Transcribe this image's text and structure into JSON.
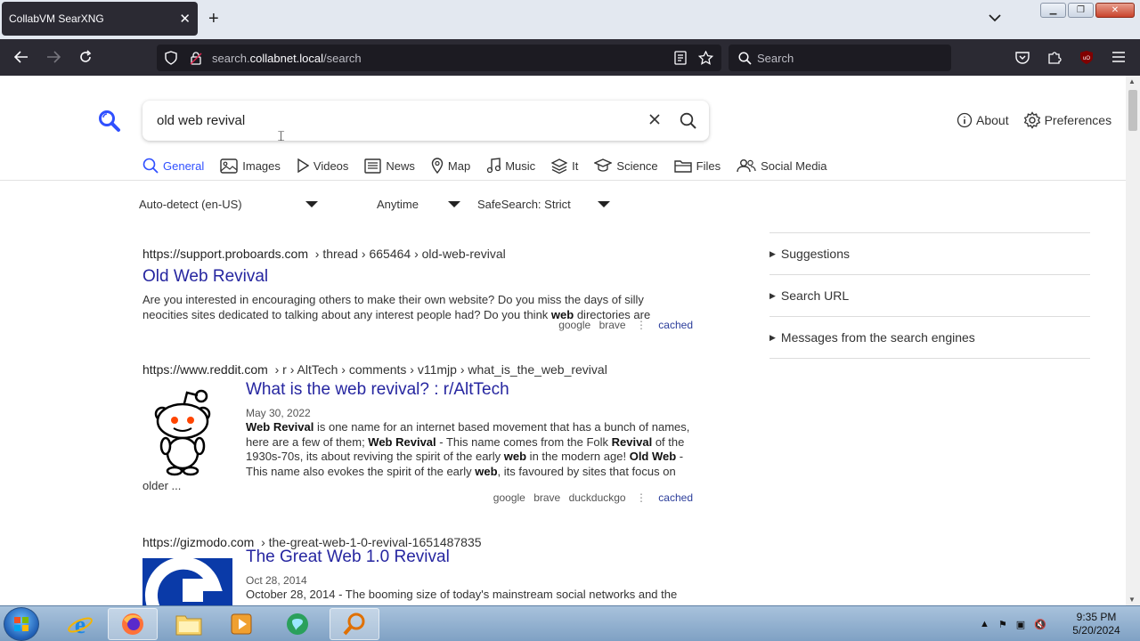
{
  "browser": {
    "tab_title": "CollabVM SearXNG",
    "url_host": "search.",
    "url_domain": "collabnet.local",
    "url_path": "/search",
    "search_placeholder": "Search"
  },
  "search": {
    "query": "old web revival"
  },
  "top_links": {
    "about": "About",
    "preferences": "Preferences"
  },
  "categories": [
    {
      "label": "General",
      "icon": "magnifier-icon"
    },
    {
      "label": "Images",
      "icon": "image-icon"
    },
    {
      "label": "Videos",
      "icon": "play-icon"
    },
    {
      "label": "News",
      "icon": "newspaper-icon"
    },
    {
      "label": "Map",
      "icon": "map-pin-icon"
    },
    {
      "label": "Music",
      "icon": "music-note-icon"
    },
    {
      "label": "It",
      "icon": "layers-icon"
    },
    {
      "label": "Science",
      "icon": "graduation-cap-icon"
    },
    {
      "label": "Files",
      "icon": "folder-icon"
    },
    {
      "label": "Social Media",
      "icon": "people-icon"
    }
  ],
  "filters": {
    "language": "Auto-detect (en-US)",
    "time": "Anytime",
    "safesearch": "SafeSearch: Strict"
  },
  "results": [
    {
      "url": "https://support.proboards.com",
      "crumbs": "› thread › 665464 › old-web-revival",
      "title": "Old Web Revival",
      "snippet_1": "Are you interested in encouraging others to make their own website? Do you miss the days of silly",
      "snippet_2a": "neocities sites dedicated to talking about any interest people had? Do you think ",
      "snippet_2b": "web",
      "snippet_2c": " directories are",
      "engines": [
        "google",
        "brave"
      ],
      "cached": "cached"
    },
    {
      "url": "https://www.reddit.com",
      "crumbs": "› r › AltTech › comments › v11mjp › what_is_the_web_revival",
      "title": "What is the web revival? : r/AltTech",
      "date": "May 30, 2022",
      "s1b": "Web Revival",
      "s1": " is one name for an internet based movement that has a bunch of names,",
      "s2": "here are a few of them; ",
      "s2b": "Web Revival",
      "s2c": " - This name comes from the Folk ",
      "s2d": "Revival",
      "s2e": " of the",
      "s3": "1930s-70s, its about reviving the spirit of the early ",
      "s3b": "web",
      "s3c": " in the modern age! ",
      "s3d": "Old Web",
      "s3e": " -",
      "s4": "This name also evokes the spirit of the early ",
      "s4b": "web",
      "s4c": ", its favoured by sites that focus on",
      "s5": "older ...",
      "engines": [
        "google",
        "brave",
        "duckduckgo"
      ],
      "cached": "cached"
    },
    {
      "url": "https://gizmodo.com",
      "crumbs": "› the-great-web-1-0-revival-1651487835",
      "title": "The Great Web 1.0 Revival",
      "date": "Oct 28, 2014",
      "snippet": "October 28, 2014 - The booming size of today's mainstream social networks and the"
    }
  ],
  "sidebar": {
    "items": [
      "Suggestions",
      "Search URL",
      "Messages from the search engines"
    ]
  },
  "taskbar": {
    "time": "9:35 PM",
    "date": "5/20/2024"
  }
}
